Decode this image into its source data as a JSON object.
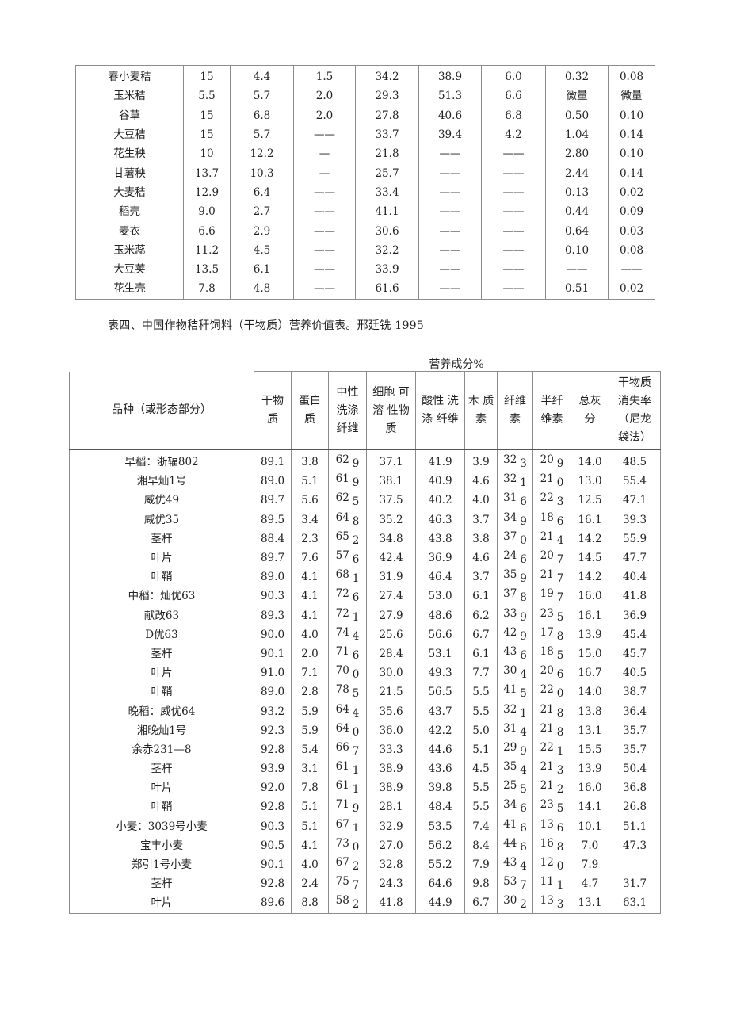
{
  "table1": {
    "rows": [
      {
        "name": "春小麦秸",
        "values": [
          "15",
          "4.4",
          "1.5",
          "34.2",
          "38.9",
          "6.0",
          "0.32",
          "0.08"
        ]
      },
      {
        "name": "玉米秸",
        "values": [
          "5.5",
          "5.7",
          "2.0",
          "29.3",
          "51.3",
          "6.6",
          "微量",
          "微量"
        ]
      },
      {
        "name": "谷草",
        "values": [
          "15",
          "6.8",
          "2.0",
          "27.8",
          "40.6",
          "6.8",
          "0.50",
          "0.10"
        ]
      },
      {
        "name": "大豆秸",
        "values": [
          "15",
          "5.7",
          "——",
          "33.7",
          "39.4",
          "4.2",
          "1.04",
          "0.14"
        ]
      },
      {
        "name": "花生秧",
        "values": [
          "10",
          "12.2",
          "—",
          "21.8",
          "——",
          "——",
          "2.80",
          "0.10"
        ]
      },
      {
        "name": "甘薯秧",
        "values": [
          "13.7",
          "10.3",
          "—",
          "25.7",
          "——",
          "——",
          "2.44",
          "0.14"
        ]
      },
      {
        "name": "大麦秸",
        "values": [
          "12.9",
          "6.4",
          "——",
          "33.4",
          "——",
          "——",
          "0.13",
          "0.02"
        ]
      },
      {
        "name": "稻壳",
        "values": [
          "9.0",
          "2.7",
          "——",
          "41.1",
          "——",
          "——",
          "0.44",
          "0.09"
        ]
      },
      {
        "name": "麦衣",
        "values": [
          "6.6",
          "2.9",
          "——",
          "30.6",
          "——",
          "——",
          "0.64",
          "0.03"
        ]
      },
      {
        "name": "玉米蕊",
        "values": [
          "11.2",
          "4.5",
          "——",
          "32.2",
          "——",
          "——",
          "0.10",
          "0.08"
        ]
      },
      {
        "name": "大豆荚",
        "values": [
          "13.5",
          "6.1",
          "——",
          "33.9",
          "——",
          "——",
          "——",
          "——"
        ]
      },
      {
        "name": "花生壳",
        "values": [
          "7.8",
          "4.8",
          "——",
          "61.6",
          "——",
          "——",
          "0.51",
          "0.02"
        ]
      }
    ]
  },
  "caption": "表四、中国作物秸秆饲料（干物质）营养价值表。邢廷铣 1995",
  "table2": {
    "group_header": "营养成分%",
    "variety_header": "品种（或形态部分）",
    "columns": [
      "干物\n质",
      "蛋白\n质",
      "中性\n洗涤\n纤维",
      "细胞 可\n溶 性物\n质",
      "酸性 洗\n涤 纤维",
      "木 质\n素",
      "纤维\n素",
      "半纤\n维素",
      "总灰\n分",
      "干物质\n消失率\n（尼龙\n袋法）"
    ],
    "rows": [
      {
        "name": "早稻：浙辐802",
        "values": [
          "89.1",
          "3.8",
          "62 9",
          "37.1",
          "41.9",
          "3.9",
          "32 3",
          "20 9",
          "14.0",
          "48.5"
        ]
      },
      {
        "name": "湘早灿1号",
        "values": [
          "89.0",
          "5.1",
          "61 9",
          "38.1",
          "40.9",
          "4.6",
          "32 1",
          "21 0",
          "13.0",
          "55.4"
        ]
      },
      {
        "name": "威优49",
        "values": [
          "89.7",
          "5.6",
          "62 5",
          "37.5",
          "40.2",
          "4.0",
          "31 6",
          "22 3",
          "12.5",
          "47.1"
        ]
      },
      {
        "name": "威优35",
        "values": [
          "89.5",
          "3.4",
          "64 8",
          "35.2",
          "46.3",
          "3.7",
          "34 9",
          "18 6",
          "16.1",
          "39.3"
        ]
      },
      {
        "name": "茎杆",
        "values": [
          "88.4",
          "2.3",
          "65 2",
          "34.8",
          "43.8",
          "3.8",
          "37 0",
          "21 4",
          "14.2",
          "55.9"
        ]
      },
      {
        "name": "叶片",
        "values": [
          "89.7",
          "7.6",
          "57 6",
          "42.4",
          "36.9",
          "4.6",
          "24 6",
          "20 7",
          "14.5",
          "47.7"
        ]
      },
      {
        "name": "叶鞘",
        "values": [
          "89.0",
          "4.1",
          "68 1",
          "31.9",
          "46.4",
          "3.7",
          "35 9",
          "21 7",
          "14.2",
          "40.4"
        ]
      },
      {
        "name": "中稻：灿优63",
        "values": [
          "90.3",
          "4.1",
          "72 6",
          "27.4",
          "53.0",
          "6.1",
          "37 8",
          "19 7",
          "16.0",
          "41.8"
        ]
      },
      {
        "name": "献改63",
        "values": [
          "89.3",
          "4.1",
          "72 1",
          "27.9",
          "48.6",
          "6.2",
          "33 9",
          "23 5",
          "16.1",
          "36.9"
        ]
      },
      {
        "name": "D优63",
        "values": [
          "90.0",
          "4.0",
          "74 4",
          "25.6",
          "56.6",
          "6.7",
          "42 9",
          "17 8",
          "13.9",
          "45.4"
        ]
      },
      {
        "name": "茎杆",
        "values": [
          "90.1",
          "2.0",
          "71 6",
          "28.4",
          "53.1",
          "6.1",
          "43 6",
          "18 5",
          "15.0",
          "45.7"
        ]
      },
      {
        "name": "叶片",
        "values": [
          "91.0",
          "7.1",
          "70 0",
          "30.0",
          "49.3",
          "7.7",
          "30 4",
          "20 6",
          "16.7",
          "40.5"
        ]
      },
      {
        "name": "叶鞘",
        "values": [
          "89.0",
          "2.8",
          "78 5",
          "21.5",
          "56.5",
          "5.5",
          "41 5",
          "22 0",
          "14.0",
          "38.7"
        ]
      },
      {
        "name": "晚稻：威优64",
        "values": [
          "93.2",
          "5.9",
          "64 4",
          "35.6",
          "43.7",
          "5.5",
          "32 1",
          "21 8",
          "13.8",
          "36.4"
        ]
      },
      {
        "name": "湘晚灿1号",
        "values": [
          "92.3",
          "5.9",
          "64 0",
          "36.0",
          "42.2",
          "5.0",
          "31 4",
          "21 8",
          "13.1",
          "35.7"
        ]
      },
      {
        "name": "余赤231—8",
        "values": [
          "92.8",
          "5.4",
          "66 7",
          "33.3",
          "44.6",
          "5.1",
          "29 9",
          "22 1",
          "15.5",
          "35.7"
        ]
      },
      {
        "name": "茎杆",
        "values": [
          "93.9",
          "3.1",
          "61 1",
          "38.9",
          "43.6",
          "4.5",
          "35 4",
          "21 3",
          "13.9",
          "50.4"
        ]
      },
      {
        "name": "叶片",
        "values": [
          "92.0",
          "7.8",
          "61 1",
          "38.9",
          "39.8",
          "5.5",
          "25 5",
          "21 2",
          "16.0",
          "36.8"
        ]
      },
      {
        "name": "叶鞘",
        "values": [
          "92.8",
          "5.1",
          "71 9",
          "28.1",
          "48.4",
          "5.5",
          "34 6",
          "23 5",
          "14.1",
          "26.8"
        ]
      },
      {
        "name": "小麦：3039号小麦",
        "values": [
          "90.3",
          "5.1",
          "67 1",
          "32.9",
          "53.5",
          "7.4",
          "41 6",
          "13 6",
          "10.1",
          "51.1"
        ]
      },
      {
        "name": "宝丰小麦",
        "values": [
          "90.5",
          "4.1",
          "73 0",
          "27.0",
          "56.2",
          "8.4",
          "44 6",
          "16 8",
          "7.0",
          "47.3"
        ]
      },
      {
        "name": "郑引1号小麦",
        "values": [
          "90.1",
          "4.0",
          "67 2",
          "32.8",
          "55.2",
          "7.9",
          "43 4",
          "12 0",
          "7.9",
          ""
        ]
      },
      {
        "name": "茎杆",
        "values": [
          "92.8",
          "2.4",
          "75 7",
          "24.3",
          "64.6",
          "9.8",
          "53 7",
          "11 1",
          "4.7",
          "31.7"
        ]
      },
      {
        "name": "叶片",
        "values": [
          "89.6",
          "8.8",
          "58 2",
          "41.8",
          "44.9",
          "6.7",
          "30 2",
          "13 3",
          "13.1",
          "63.1"
        ]
      }
    ]
  }
}
